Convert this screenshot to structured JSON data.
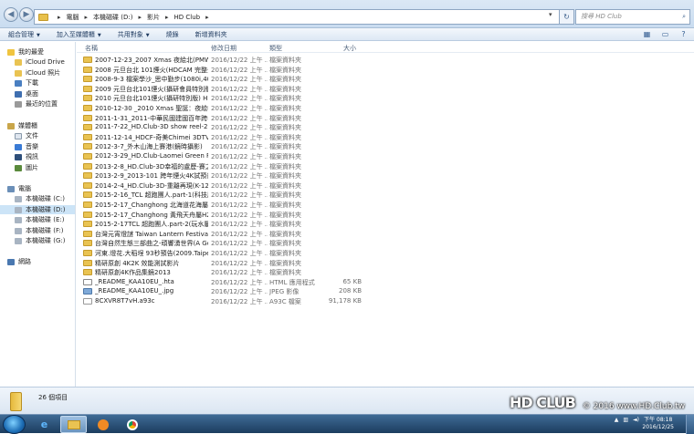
{
  "address": {
    "crumbs": [
      "電腦",
      "本機磁碟 (D:)",
      "影片",
      "HD Club"
    ],
    "search_placeholder": "搜尋 HD Club"
  },
  "toolbar": {
    "organize": "組合管理",
    "add_to_library": "加入至媒體櫃",
    "share": "共用對象",
    "burn": "燒錄",
    "new_folder": "新增資料夾"
  },
  "nav": {
    "favorites": "我的最愛",
    "favorites_items": [
      "iCloud Drive",
      "iCloud 照片",
      "下載",
      "桌面",
      "最近的位置"
    ],
    "libraries": "媒體櫃",
    "library_items": [
      "文件",
      "音樂",
      "視訊",
      "圖片"
    ],
    "computer": "電腦",
    "drives": [
      "本機磁碟 (C:)",
      "本機磁碟 (D:)",
      "本機磁碟 (E:)",
      "本機磁碟 (F:)",
      "本機磁碟 (G:)"
    ],
    "network": "網路"
  },
  "columns": {
    "name": "名稱",
    "date": "修改日期",
    "type": "類型",
    "size": "大小"
  },
  "files": [
    {
      "name": "2007-12-23_2007 Xmas 夜絵北(PMW-...",
      "date": "2016/12/22 上午 ...",
      "type": "檔案資料夾",
      "size": "",
      "icon": "folder"
    },
    {
      "name": "2008 元旦台北 101煙火(HDCAM 完整全...",
      "date": "2016/12/22 上午 ...",
      "type": "檔案資料夾",
      "size": "",
      "icon": "folder"
    },
    {
      "name": "2008-9-3 檔案學沙_思中勤步(1080i,40...",
      "date": "2016/12/22 上午 ...",
      "type": "檔案資料夾",
      "size": "",
      "icon": "folder"
    },
    {
      "name": "2009 元旦台北101煙火(攝研會員特別版)...",
      "date": "2016/12/22 上午 ...",
      "type": "檔案資料夾",
      "size": "",
      "icon": "folder"
    },
    {
      "name": "2010 元旦台北101煙火(攝研特別版) HD ...",
      "date": "2016/12/22 上午 ...",
      "type": "檔案資料夾",
      "size": "",
      "icon": "folder"
    },
    {
      "name": "2010-12-30 _2010 Xmas 聖誕：夜絵嘴(...",
      "date": "2016/12/22 上午 ...",
      "type": "檔案資料夾",
      "size": "",
      "icon": "folder"
    },
    {
      "name": "2011-1-31_2011-中華民國建國百年跨年...",
      "date": "2016/12/22 上午 ...",
      "type": "檔案資料夾",
      "size": "",
      "icon": "folder"
    },
    {
      "name": "2011-7-22_HD.Club-3D show reel-201...",
      "date": "2016/12/22 上午 ...",
      "type": "檔案資料夾",
      "size": "",
      "icon": "folder"
    },
    {
      "name": "2011-12-14_HDCF-奇美Chimei 3DTV-...",
      "date": "2016/12/22 上午 ...",
      "type": "檔案資料夾",
      "size": "",
      "icon": "folder"
    },
    {
      "name": "2012-3-7_外木山海上賽港(鏡時攝影)",
      "date": "2016/12/22 上午 ...",
      "type": "檔案資料夾",
      "size": "",
      "icon": "folder"
    },
    {
      "name": "2012-3-29_HD.Club-Laomei Green Re...",
      "date": "2016/12/22 上午 ...",
      "type": "檔案資料夾",
      "size": "",
      "icon": "folder"
    },
    {
      "name": "2013-2-8_HD.Club-3D幸福的盧歷-賽之...",
      "date": "2016/12/22 上午 ...",
      "type": "檔案資料夾",
      "size": "",
      "icon": "folder"
    },
    {
      "name": "2013-2-9_2013-101 跨年煙火4K試預告",
      "date": "2016/12/22 上午 ...",
      "type": "檔案資料夾",
      "size": "",
      "icon": "folder"
    },
    {
      "name": "2014-2-4_HD.Club-3D-重離再現(K-12...",
      "date": "2016/12/22 上午 ...",
      "type": "檔案資料夾",
      "size": "",
      "icon": "folder"
    },
    {
      "name": "2015-2-16_TCL 超跑團人.part-1(科技屬)...",
      "date": "2016/12/22 上午 ...",
      "type": "檔案資料夾",
      "size": "",
      "icon": "folder"
    },
    {
      "name": "2015-2-17_Changhong 北海道花海屬H...",
      "date": "2016/12/22 上午 ...",
      "type": "檔案資料夾",
      "size": "",
      "icon": "folder"
    },
    {
      "name": "2015-2-17_Changhong 黃飛天舟屬H26...",
      "date": "2016/12/22 上午 ...",
      "type": "檔案資料夾",
      "size": "",
      "icon": "folder"
    },
    {
      "name": "2015-2-17TCL 超跑團人.part-2(玩水屬)...",
      "date": "2016/12/22 上午 ...",
      "type": "檔案資料夾",
      "size": "",
      "icon": "folder"
    },
    {
      "name": "台灣元宵燈謎 Taiwan Lantern Festival (...",
      "date": "2016/12/22 上午 ...",
      "type": "檔案資料夾",
      "size": "",
      "icon": "folder"
    },
    {
      "name": "台灣自然生態三部曲之-頑響湧世界(A Go...",
      "date": "2016/12/22 上午 ...",
      "type": "檔案資料夾",
      "size": "",
      "icon": "folder"
    },
    {
      "name": "河東.燈花.大稻埕 93秒預告(2009.Taipei...",
      "date": "2016/12/22 上午 ...",
      "type": "檔案資料夾",
      "size": "",
      "icon": "folder"
    },
    {
      "name": "精研原創 4K2K 效能測試影片",
      "date": "2016/12/22 上午 ...",
      "type": "檔案資料夾",
      "size": "",
      "icon": "folder"
    },
    {
      "name": "精研原創4K作品集鏡2013",
      "date": "2016/12/22 上午 ...",
      "type": "檔案資料夾",
      "size": "",
      "icon": "folder"
    },
    {
      "name": "_README_KAA10EU_.hta",
      "date": "2016/12/22 上午 ...",
      "type": "HTML 應用程式",
      "size": "65 KB",
      "icon": "hta"
    },
    {
      "name": "_README_KAA10EU_.jpg",
      "date": "2016/12/22 上午 ...",
      "type": "JPEG 影像",
      "size": "208 KB",
      "icon": "jpg"
    },
    {
      "name": "8CXVR8T7vH.a93c",
      "date": "2016/12/22 上午 ...",
      "type": "A93C 檔案",
      "size": "91,178 KB",
      "icon": "a93c"
    }
  ],
  "status": {
    "count": "26 個項目"
  },
  "watermark": {
    "logo": "HD CLUB",
    "text": "© 2016  www.HD.Club.tw"
  },
  "taskbar": {
    "apps": [
      "ie-icon",
      "explorer-icon",
      "media-player-icon",
      "chrome-icon"
    ],
    "time": "下午 08:18",
    "date": "2016/12/25"
  },
  "colors": {
    "folder": "#e9c352",
    "selection": "#cce4f7",
    "taskbar": "#1c3d5f"
  }
}
